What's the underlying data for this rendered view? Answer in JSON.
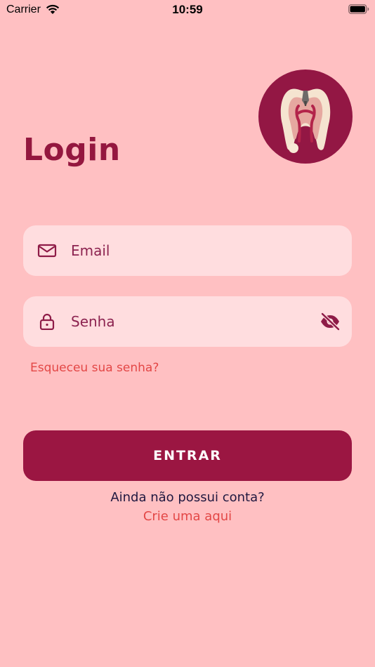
{
  "status_bar": {
    "carrier": "Carrier",
    "time": "10:59",
    "icons": [
      "wifi-icon",
      "battery-icon"
    ]
  },
  "logo": {
    "icon": "tooth-icon"
  },
  "title": "Login",
  "form": {
    "email": {
      "placeholder": "Email",
      "value": "",
      "icon": "mail-icon"
    },
    "password": {
      "placeholder": "Senha",
      "value": "",
      "icon": "lock-icon",
      "toggle_icon": "eye-off-icon"
    },
    "forgot_label": "Esqueceu sua senha?",
    "submit_label": "ENTRAR"
  },
  "signup": {
    "prompt": "Ainda não possui conta?",
    "link_label": "Crie uma aqui"
  },
  "colors": {
    "background": "#FFC0C2",
    "primary": "#9B1642",
    "field_background": "#FFDDDF",
    "link": "#E34746"
  }
}
